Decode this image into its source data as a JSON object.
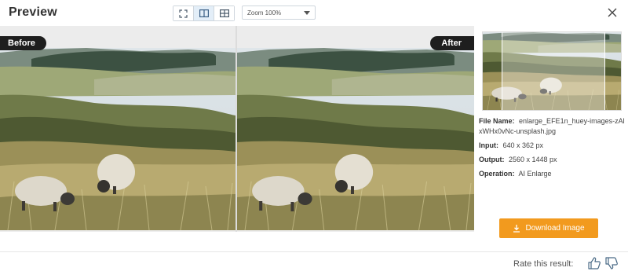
{
  "header": {
    "title": "Preview",
    "zoom_label": "Zoom  100%"
  },
  "comparison": {
    "before_label": "Before",
    "after_label": "After"
  },
  "info": {
    "file_name_key": "File Name:",
    "file_name_value": "enlarge_EFE1n_huey-images-zAlxWHx0vNc-unsplash.jpg",
    "input_key": "Input:",
    "input_value": "640 x 362 px",
    "output_key": "Output:",
    "output_value": "2560 x 1448 px",
    "operation_key": "Operation:",
    "operation_value": "AI Enlarge"
  },
  "actions": {
    "download_label": "Download Image"
  },
  "footer": {
    "rate_label": "Rate this result:"
  },
  "colors": {
    "accent": "#f29a1e",
    "tag_bg": "#1e1e1e",
    "active_view": "#e3eef8"
  },
  "icons": [
    "fullscreen-icon",
    "split-view-icon",
    "side-by-side-icon",
    "chevron-down-icon",
    "close-icon",
    "download-icon",
    "thumbs-up-icon",
    "thumbs-down-icon"
  ]
}
